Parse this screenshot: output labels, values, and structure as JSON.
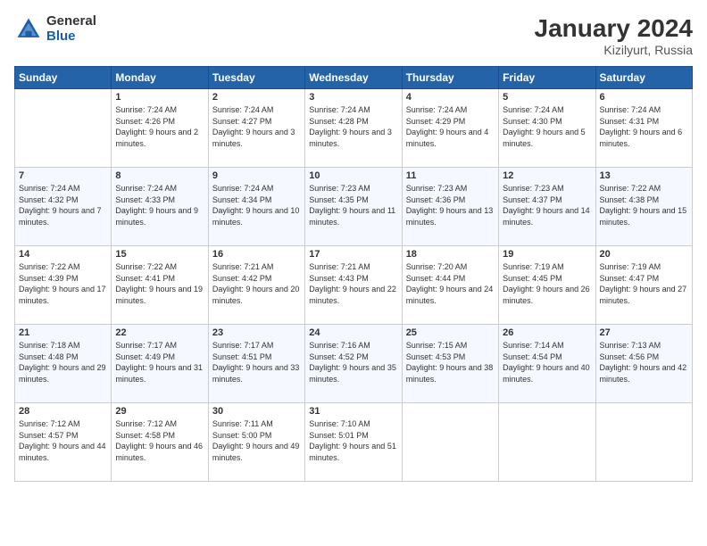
{
  "logo": {
    "general": "General",
    "blue": "Blue"
  },
  "title": "January 2024",
  "subtitle": "Kizilyurt, Russia",
  "days": [
    "Sunday",
    "Monday",
    "Tuesday",
    "Wednesday",
    "Thursday",
    "Friday",
    "Saturday"
  ],
  "weeks": [
    [
      {
        "day": "",
        "sunrise": "",
        "sunset": "",
        "daylight": ""
      },
      {
        "day": "1",
        "sunrise": "Sunrise: 7:24 AM",
        "sunset": "Sunset: 4:26 PM",
        "daylight": "Daylight: 9 hours and 2 minutes."
      },
      {
        "day": "2",
        "sunrise": "Sunrise: 7:24 AM",
        "sunset": "Sunset: 4:27 PM",
        "daylight": "Daylight: 9 hours and 3 minutes."
      },
      {
        "day": "3",
        "sunrise": "Sunrise: 7:24 AM",
        "sunset": "Sunset: 4:28 PM",
        "daylight": "Daylight: 9 hours and 3 minutes."
      },
      {
        "day": "4",
        "sunrise": "Sunrise: 7:24 AM",
        "sunset": "Sunset: 4:29 PM",
        "daylight": "Daylight: 9 hours and 4 minutes."
      },
      {
        "day": "5",
        "sunrise": "Sunrise: 7:24 AM",
        "sunset": "Sunset: 4:30 PM",
        "daylight": "Daylight: 9 hours and 5 minutes."
      },
      {
        "day": "6",
        "sunrise": "Sunrise: 7:24 AM",
        "sunset": "Sunset: 4:31 PM",
        "daylight": "Daylight: 9 hours and 6 minutes."
      }
    ],
    [
      {
        "day": "7",
        "sunrise": "Sunrise: 7:24 AM",
        "sunset": "Sunset: 4:32 PM",
        "daylight": "Daylight: 9 hours and 7 minutes."
      },
      {
        "day": "8",
        "sunrise": "Sunrise: 7:24 AM",
        "sunset": "Sunset: 4:33 PM",
        "daylight": "Daylight: 9 hours and 9 minutes."
      },
      {
        "day": "9",
        "sunrise": "Sunrise: 7:24 AM",
        "sunset": "Sunset: 4:34 PM",
        "daylight": "Daylight: 9 hours and 10 minutes."
      },
      {
        "day": "10",
        "sunrise": "Sunrise: 7:23 AM",
        "sunset": "Sunset: 4:35 PM",
        "daylight": "Daylight: 9 hours and 11 minutes."
      },
      {
        "day": "11",
        "sunrise": "Sunrise: 7:23 AM",
        "sunset": "Sunset: 4:36 PM",
        "daylight": "Daylight: 9 hours and 13 minutes."
      },
      {
        "day": "12",
        "sunrise": "Sunrise: 7:23 AM",
        "sunset": "Sunset: 4:37 PM",
        "daylight": "Daylight: 9 hours and 14 minutes."
      },
      {
        "day": "13",
        "sunrise": "Sunrise: 7:22 AM",
        "sunset": "Sunset: 4:38 PM",
        "daylight": "Daylight: 9 hours and 15 minutes."
      }
    ],
    [
      {
        "day": "14",
        "sunrise": "Sunrise: 7:22 AM",
        "sunset": "Sunset: 4:39 PM",
        "daylight": "Daylight: 9 hours and 17 minutes."
      },
      {
        "day": "15",
        "sunrise": "Sunrise: 7:22 AM",
        "sunset": "Sunset: 4:41 PM",
        "daylight": "Daylight: 9 hours and 19 minutes."
      },
      {
        "day": "16",
        "sunrise": "Sunrise: 7:21 AM",
        "sunset": "Sunset: 4:42 PM",
        "daylight": "Daylight: 9 hours and 20 minutes."
      },
      {
        "day": "17",
        "sunrise": "Sunrise: 7:21 AM",
        "sunset": "Sunset: 4:43 PM",
        "daylight": "Daylight: 9 hours and 22 minutes."
      },
      {
        "day": "18",
        "sunrise": "Sunrise: 7:20 AM",
        "sunset": "Sunset: 4:44 PM",
        "daylight": "Daylight: 9 hours and 24 minutes."
      },
      {
        "day": "19",
        "sunrise": "Sunrise: 7:19 AM",
        "sunset": "Sunset: 4:45 PM",
        "daylight": "Daylight: 9 hours and 26 minutes."
      },
      {
        "day": "20",
        "sunrise": "Sunrise: 7:19 AM",
        "sunset": "Sunset: 4:47 PM",
        "daylight": "Daylight: 9 hours and 27 minutes."
      }
    ],
    [
      {
        "day": "21",
        "sunrise": "Sunrise: 7:18 AM",
        "sunset": "Sunset: 4:48 PM",
        "daylight": "Daylight: 9 hours and 29 minutes."
      },
      {
        "day": "22",
        "sunrise": "Sunrise: 7:17 AM",
        "sunset": "Sunset: 4:49 PM",
        "daylight": "Daylight: 9 hours and 31 minutes."
      },
      {
        "day": "23",
        "sunrise": "Sunrise: 7:17 AM",
        "sunset": "Sunset: 4:51 PM",
        "daylight": "Daylight: 9 hours and 33 minutes."
      },
      {
        "day": "24",
        "sunrise": "Sunrise: 7:16 AM",
        "sunset": "Sunset: 4:52 PM",
        "daylight": "Daylight: 9 hours and 35 minutes."
      },
      {
        "day": "25",
        "sunrise": "Sunrise: 7:15 AM",
        "sunset": "Sunset: 4:53 PM",
        "daylight": "Daylight: 9 hours and 38 minutes."
      },
      {
        "day": "26",
        "sunrise": "Sunrise: 7:14 AM",
        "sunset": "Sunset: 4:54 PM",
        "daylight": "Daylight: 9 hours and 40 minutes."
      },
      {
        "day": "27",
        "sunrise": "Sunrise: 7:13 AM",
        "sunset": "Sunset: 4:56 PM",
        "daylight": "Daylight: 9 hours and 42 minutes."
      }
    ],
    [
      {
        "day": "28",
        "sunrise": "Sunrise: 7:12 AM",
        "sunset": "Sunset: 4:57 PM",
        "daylight": "Daylight: 9 hours and 44 minutes."
      },
      {
        "day": "29",
        "sunrise": "Sunrise: 7:12 AM",
        "sunset": "Sunset: 4:58 PM",
        "daylight": "Daylight: 9 hours and 46 minutes."
      },
      {
        "day": "30",
        "sunrise": "Sunrise: 7:11 AM",
        "sunset": "Sunset: 5:00 PM",
        "daylight": "Daylight: 9 hours and 49 minutes."
      },
      {
        "day": "31",
        "sunrise": "Sunrise: 7:10 AM",
        "sunset": "Sunset: 5:01 PM",
        "daylight": "Daylight: 9 hours and 51 minutes."
      },
      {
        "day": "",
        "sunrise": "",
        "sunset": "",
        "daylight": ""
      },
      {
        "day": "",
        "sunrise": "",
        "sunset": "",
        "daylight": ""
      },
      {
        "day": "",
        "sunrise": "",
        "sunset": "",
        "daylight": ""
      }
    ]
  ]
}
